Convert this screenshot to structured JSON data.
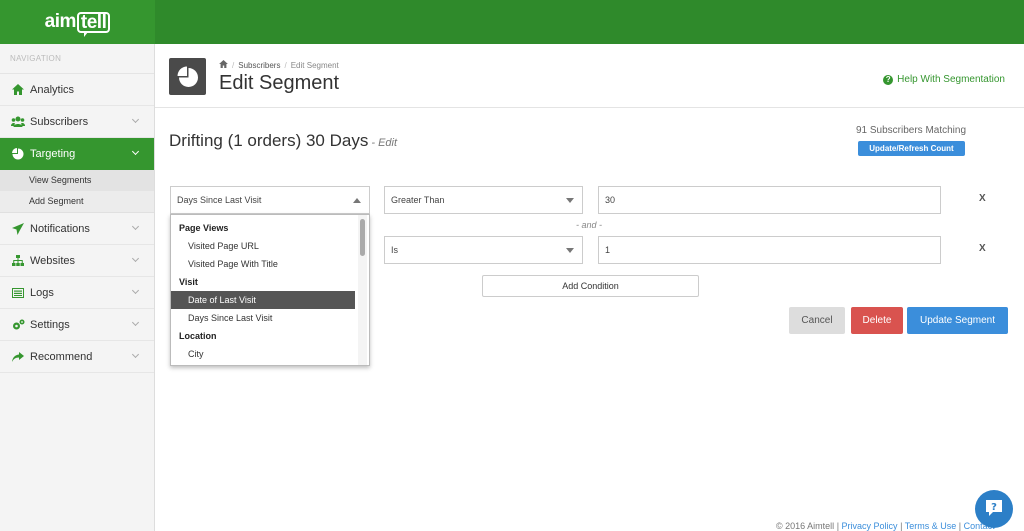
{
  "brand": {
    "logo_left": "aim",
    "logo_right": "tell"
  },
  "sidebar": {
    "heading": "NAVIGATION",
    "items": [
      {
        "label": "Analytics",
        "icon": "home-icon"
      },
      {
        "label": "Subscribers",
        "icon": "users-icon"
      },
      {
        "label": "Targeting",
        "icon": "pie-chart-icon",
        "active": true
      },
      {
        "label": "Notifications",
        "icon": "paper-plane-icon"
      },
      {
        "label": "Websites",
        "icon": "sitemap-icon"
      },
      {
        "label": "Logs",
        "icon": "list-icon"
      },
      {
        "label": "Settings",
        "icon": "gears-icon"
      },
      {
        "label": "Recommend",
        "icon": "share-icon"
      }
    ],
    "targeting_sub": [
      "View Segments",
      "Add Segment"
    ]
  },
  "header": {
    "breadcrumb": [
      "Subscribers",
      "Edit Segment"
    ],
    "title": "Edit Segment",
    "help": "Help With Segmentation"
  },
  "segment": {
    "name": "Drifting (1 orders) 30 Days",
    "edit_label": "- Edit",
    "matching": "91 Subscribers Matching",
    "refresh_label": "Update/Refresh Count"
  },
  "conditions": [
    {
      "field": "Days Since Last Visit",
      "operator": "Greater Than",
      "value": "30",
      "remove": "X"
    },
    {
      "field": "",
      "operator": "Is",
      "value": "1",
      "remove": "X"
    }
  ],
  "and_label": "- and -",
  "add_condition": "Add Condition",
  "actions": {
    "cancel": "Cancel",
    "delete": "Delete",
    "update": "Update Segment"
  },
  "dropdown": {
    "groups": [
      {
        "label": "Page Views",
        "options": [
          "Visited Page URL",
          "Visited Page With Title"
        ]
      },
      {
        "label": "Visit",
        "options": [
          "Date of Last Visit",
          "Days Since Last Visit"
        ]
      },
      {
        "label": "Location",
        "options": [
          "City"
        ]
      }
    ],
    "highlighted": "Date of Last Visit"
  },
  "footer": {
    "copyright": "© 2016 Aimtell",
    "links": [
      "Privacy Policy",
      "Terms & Use",
      "Contact"
    ]
  },
  "colors": {
    "brand_green": "#35962f",
    "topbar_green": "#2f8a2b",
    "primary_blue": "#3b8edb",
    "danger_red": "#d9534f"
  }
}
